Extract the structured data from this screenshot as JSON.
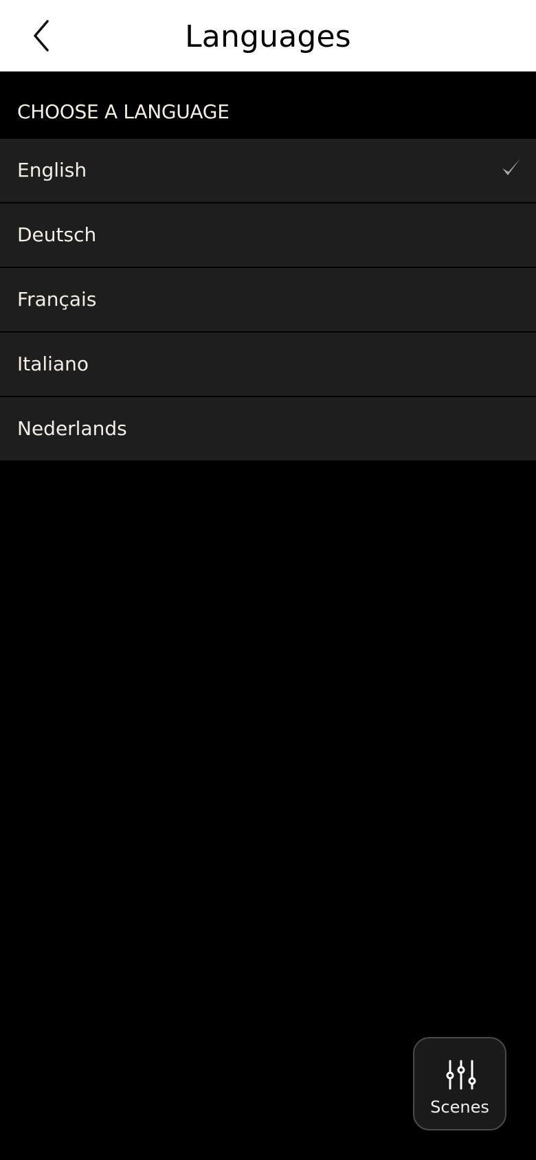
{
  "header": {
    "title": "Languages",
    "back_icon": "chevron-left-icon"
  },
  "section": {
    "title": "CHOOSE A LANGUAGE"
  },
  "languages": [
    {
      "label": "English",
      "selected": true
    },
    {
      "label": "Deutsch",
      "selected": false
    },
    {
      "label": "Français",
      "selected": false
    },
    {
      "label": "Italiano",
      "selected": false
    },
    {
      "label": "Nederlands",
      "selected": false
    }
  ],
  "scenes_button": {
    "label": "Scenes",
    "icon": "sliders-icon"
  },
  "colors": {
    "background": "#000000",
    "header_bg": "#ffffff",
    "row_bg": "#1e1e1e",
    "text": "#f4efe6",
    "check": "#a8a8a8"
  }
}
